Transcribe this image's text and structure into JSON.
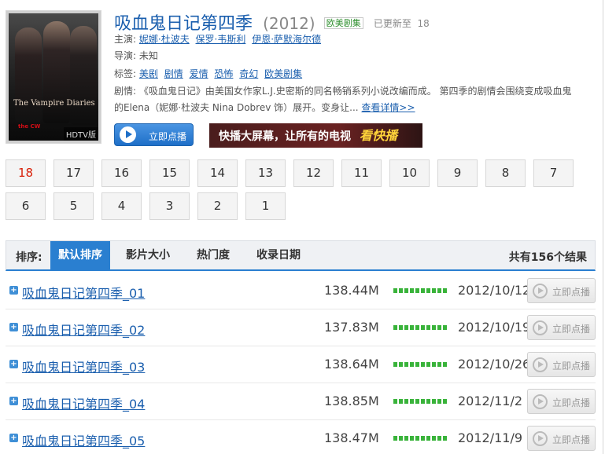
{
  "colors": {
    "accent": "#1b5fae",
    "active_episode": "#d81e06",
    "tab_blue": "#2a7fd0",
    "bar_green": "#39b33a"
  },
  "poster": {
    "title_text": "The Vampire Diaries",
    "network": "the CW",
    "badge": "HDTV版"
  },
  "show": {
    "title": "吸血鬼日记第四季",
    "year": "(2012)",
    "genre": "欧美剧集",
    "updated_label": "已更新至",
    "updated_ep": "18"
  },
  "info": {
    "actors_label": "主演:",
    "actors": [
      "妮娜·杜波夫",
      "保罗·韦斯利",
      "伊恩·萨默海尔德"
    ],
    "director_label": "导演:",
    "director": "未知",
    "tags_label": "标签:",
    "tags": [
      "美剧",
      "剧情",
      "爱情",
      "恐怖",
      "奇幻",
      "欧美剧集"
    ],
    "plot_label": "剧情:",
    "plot": "《吸血鬼日记》由美国女作家L.J.史密斯的同名畅销系列小说改编而成。      第四季的剧情会围绕变成吸血鬼的Elena（妮娜·杜波夫  Nina Dobrev 饰）展开。变身让...",
    "more_link": "查看详情>>"
  },
  "play_button": "立即点播",
  "banner": {
    "text": "快播大屏幕，让所有的电视",
    "highlight": "看快播"
  },
  "episodes": [
    "18",
    "17",
    "16",
    "15",
    "14",
    "13",
    "12",
    "11",
    "10",
    "9",
    "8",
    "7",
    "6",
    "5",
    "4",
    "3",
    "2",
    "1"
  ],
  "sort": {
    "label": "排序:",
    "tabs": [
      "默认排序",
      "影片大小",
      "热门度",
      "收录日期"
    ],
    "total": "共有156个结果"
  },
  "rows": [
    {
      "name": "吸血鬼日记第四季_01",
      "size": "138.44M",
      "date": "2012/10/12",
      "button": "立即点播"
    },
    {
      "name": "吸血鬼日记第四季_02",
      "size": "137.83M",
      "date": "2012/10/19",
      "button": "立即点播"
    },
    {
      "name": "吸血鬼日记第四季_03",
      "size": "138.64M",
      "date": "2012/10/26",
      "button": "立即点播"
    },
    {
      "name": "吸血鬼日记第四季_04",
      "size": "138.85M",
      "date": "2012/11/2",
      "button": "立即点播"
    },
    {
      "name": "吸血鬼日记第四季_05",
      "size": "138.47M",
      "date": "2012/11/9",
      "button": "立即点播"
    }
  ]
}
